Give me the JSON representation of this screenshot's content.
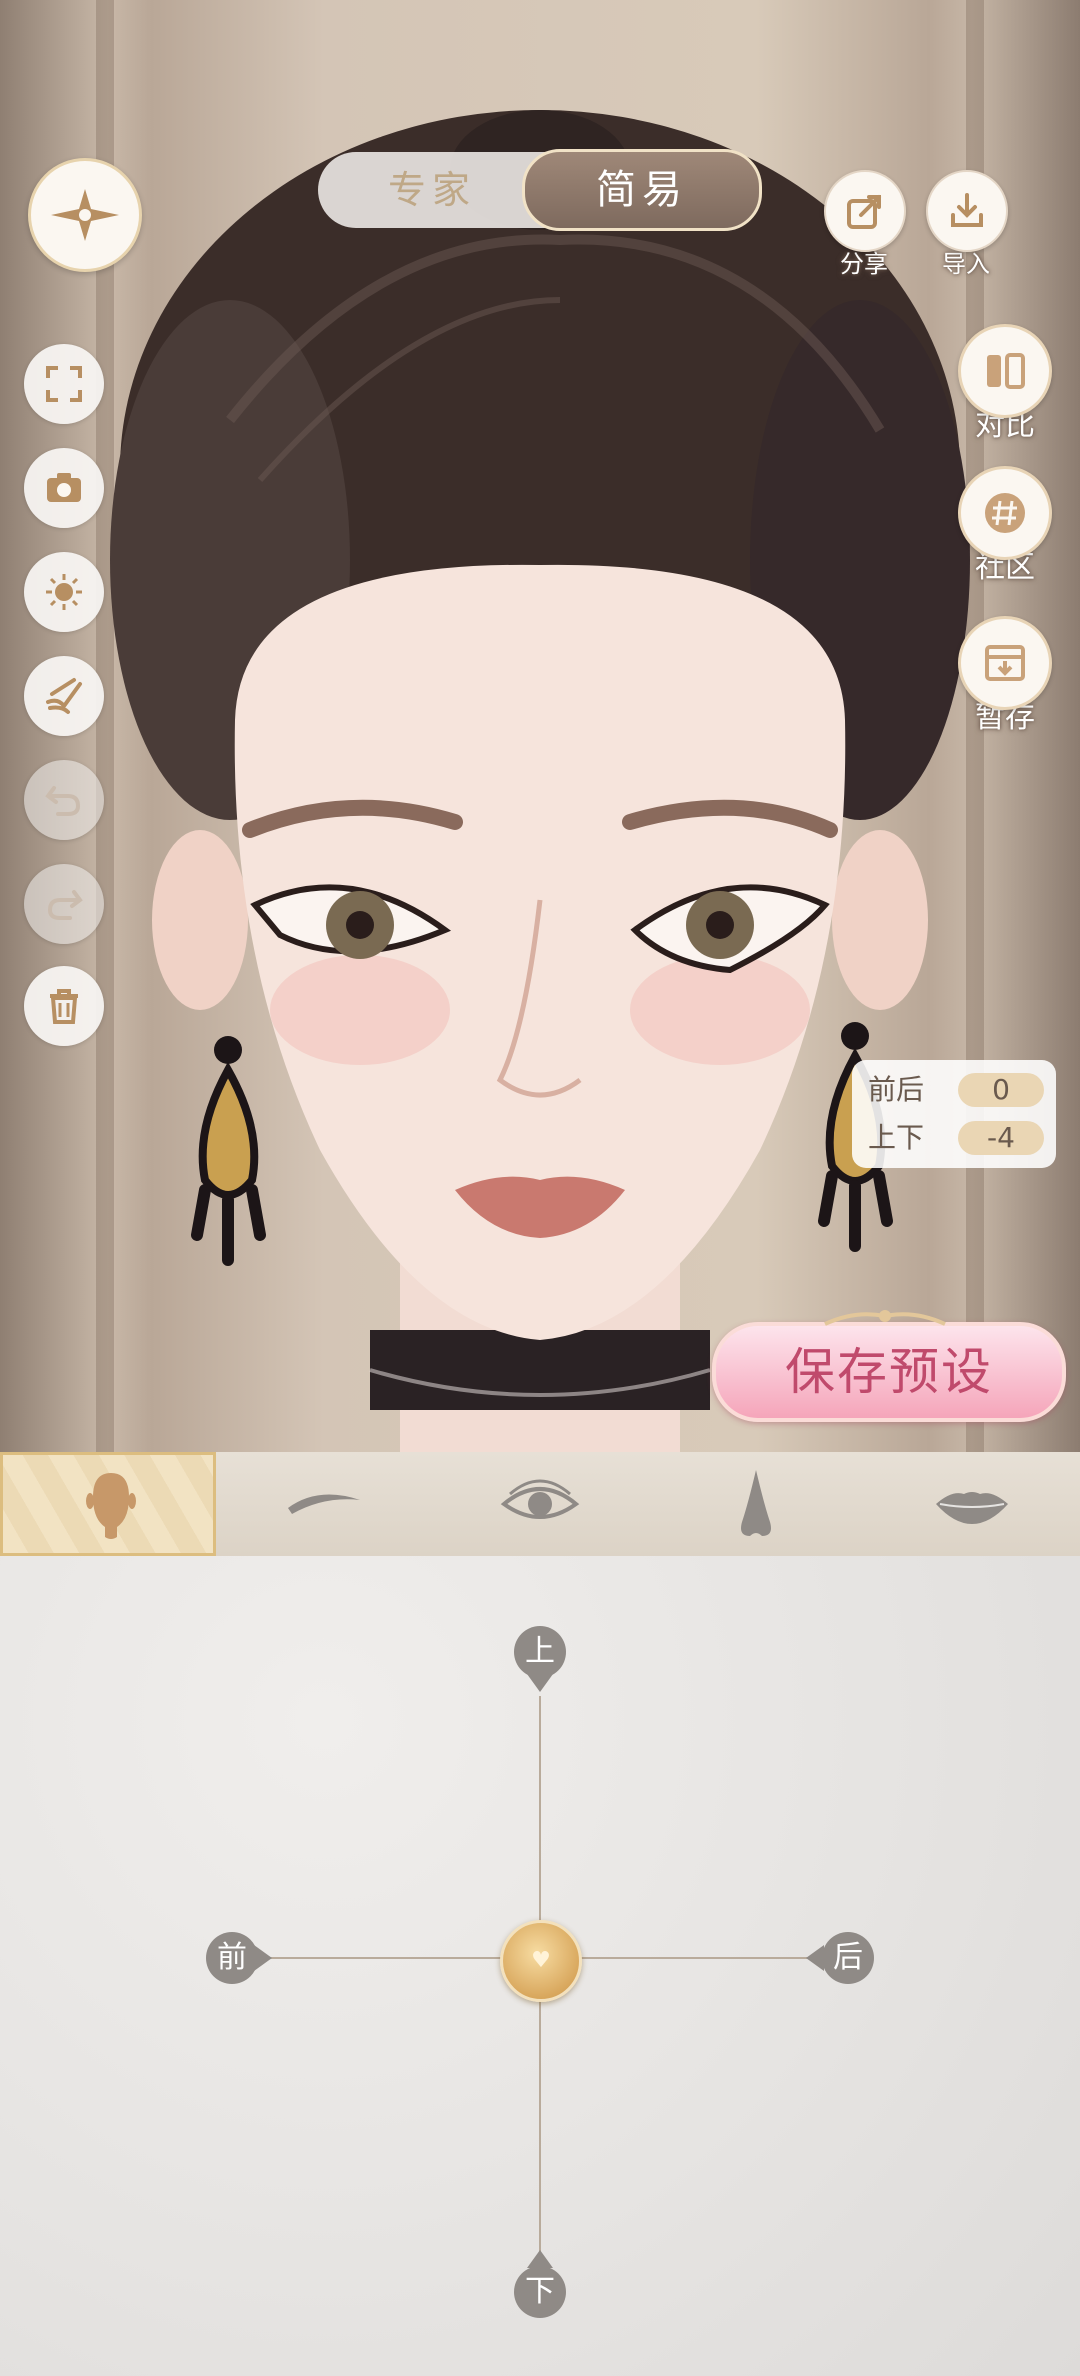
{
  "mode_toggle": {
    "expert": "专家",
    "simple": "简易",
    "selected": "简易"
  },
  "top_actions": {
    "share": "分享",
    "import": "导入"
  },
  "left_tools": [
    {
      "name": "fullscreen-icon",
      "enabled": true
    },
    {
      "name": "camera-icon",
      "enabled": true
    },
    {
      "name": "lighting-icon",
      "enabled": true
    },
    {
      "name": "hand-pose-icon",
      "enabled": true
    },
    {
      "name": "undo-icon",
      "enabled": false
    },
    {
      "name": "redo-icon",
      "enabled": false
    },
    {
      "name": "trash-icon",
      "enabled": true
    }
  ],
  "right_tools": {
    "compare": "对比",
    "community": "社区",
    "temp_save": "暂存"
  },
  "readout": {
    "front_back_label": "前后",
    "front_back_value": "0",
    "up_down_label": "上下",
    "up_down_value": "-4"
  },
  "save_preset": "保存预设",
  "tabs": [
    {
      "icon": "face-icon",
      "active": true
    },
    {
      "icon": "eyebrow-icon",
      "active": false
    },
    {
      "icon": "eye-icon",
      "active": false
    },
    {
      "icon": "nose-icon",
      "active": false
    },
    {
      "icon": "lips-icon",
      "active": false
    }
  ],
  "joystick": {
    "up": "上",
    "down": "下",
    "front": "前",
    "back": "后",
    "knob_position": {
      "front_back": 0,
      "up_down": -4
    }
  },
  "colors": {
    "accent_gold": "#d9a85e",
    "save_pink": "#f5a5ba",
    "mode_brown": "#8a7466"
  }
}
